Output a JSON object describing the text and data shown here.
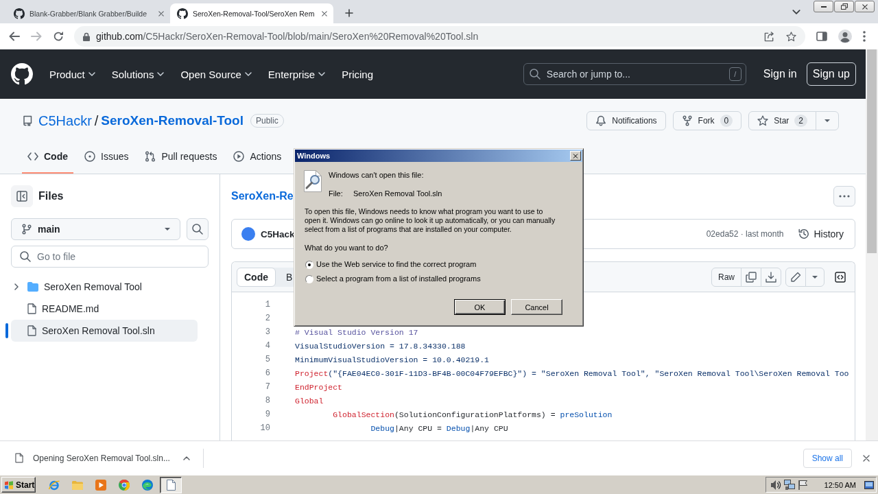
{
  "browser": {
    "tabs": [
      {
        "title": "Blank-Grabber/Blank Grabber/Builde",
        "selected": false
      },
      {
        "title": "SeroXen-Removal-Tool/SeroXen Rem",
        "selected": true
      }
    ],
    "url": {
      "host": "github.com",
      "path": "/C5Hackr/SeroXen-Removal-Tool/blob/main/SeroXen%20Removal%20Tool.sln"
    }
  },
  "header": {
    "nav": [
      {
        "label": "Product",
        "dropdown": true
      },
      {
        "label": "Solutions",
        "dropdown": true
      },
      {
        "label": "Open Source",
        "dropdown": true
      },
      {
        "label": "Enterprise",
        "dropdown": true
      },
      {
        "label": "Pricing",
        "dropdown": false
      }
    ],
    "search": {
      "placeholder": "Search or jump to...",
      "shortcut": "/"
    },
    "sign_in": "Sign in",
    "sign_up": "Sign up"
  },
  "repo": {
    "owner": "C5Hackr",
    "separator": "/",
    "name": "SeroXen-Removal-Tool",
    "visibility": "Public",
    "buttons": [
      {
        "label": "Notifications",
        "dropdown": false
      },
      {
        "label": "Fork",
        "count": "0",
        "dropdown": false
      },
      {
        "label": "Star",
        "count": "2",
        "dropdown": true
      }
    ],
    "tabs": [
      {
        "label": "Code",
        "selected": true
      },
      {
        "label": "Issues",
        "selected": false
      },
      {
        "label": "Pull requests",
        "selected": false
      },
      {
        "label": "Actions",
        "selected": false
      }
    ]
  },
  "sidebar": {
    "title": "Files",
    "branch": "main",
    "file_search": {
      "placeholder": "Go to file"
    },
    "tree": [
      {
        "name": "SeroXen Removal Tool",
        "kind": "folder",
        "expanded": false,
        "selected": false
      },
      {
        "name": "README.md",
        "kind": "file",
        "selected": false
      },
      {
        "name": "SeroXen Removal Tool.sln",
        "kind": "file",
        "selected": true
      }
    ]
  },
  "file": {
    "breadcrumb": "SeroXen-Re",
    "commit": {
      "author": "C5Hack",
      "meta": "02eda52 · last month",
      "history": "History"
    },
    "views": [
      {
        "label": "Code",
        "selected": true
      },
      {
        "label": "B",
        "selected": false
      }
    ],
    "raw": "Raw",
    "lines": [
      {
        "number": "1"
      },
      {
        "number": "2"
      },
      {
        "number": "3",
        "tokens": [
          {
            "text": "# Visual Studio Version 17",
            "kind": "comment"
          }
        ]
      },
      {
        "number": "4",
        "tokens": [
          {
            "text": "VisualStudioVersion = 17.8.34330.188",
            "kind": "string"
          }
        ]
      },
      {
        "number": "5",
        "tokens": [
          {
            "text": "MinimumVisualStudioVersion = 10.0.40219.1",
            "kind": "string"
          }
        ]
      },
      {
        "number": "6",
        "tokens": [
          {
            "text": "Project",
            "kind": "keyword"
          },
          {
            "text": "(\"{FAE04EC0-301F-11D3-BF4B-00C04F79EFBC}\") = \"SeroXen Removal Tool\", \"SeroXen Removal Tool\\SeroXen Removal Too",
            "kind": "string"
          }
        ]
      },
      {
        "number": "7",
        "tokens": [
          {
            "text": "EndProject",
            "kind": "keyword"
          }
        ]
      },
      {
        "number": "8",
        "tokens": [
          {
            "text": "Global",
            "kind": "keyword"
          }
        ]
      },
      {
        "number": "9",
        "tokens": [
          {
            "text": "\tGlobalSection",
            "kind": "keyword"
          },
          {
            "text": "(SolutionConfigurationPlatforms) = ",
            "kind": "plain"
          },
          {
            "text": "preSolution",
            "kind": "constant"
          }
        ]
      },
      {
        "number": "10",
        "tokens": [
          {
            "text": "\t\tDebug",
            "kind": "constant"
          },
          {
            "text": "|Any CPU = ",
            "kind": "plain"
          },
          {
            "text": "Debug",
            "kind": "constant"
          },
          {
            "text": "|Any CPU",
            "kind": "plain"
          }
        ]
      }
    ]
  },
  "downloads": {
    "item": "Opening SeroXen Removal Tool.sln...",
    "show_all": "Show all"
  },
  "dialog": {
    "title": "Windows",
    "heading": "Windows can't open this file:",
    "file_label": "File:",
    "file_name": "SeroXen Removal Tool.sln",
    "message": "To open this file, Windows needs to know what program you want to use to open it. Windows can go online to look it up automatically, or you can manually select from a list of programs that are installed on your computer.",
    "question": "What do you want to do?",
    "options": [
      {
        "label": "Use the Web service to find the correct program",
        "selected": true
      },
      {
        "label": "Select a program from a list of installed programs",
        "selected": false
      }
    ],
    "buttons": [
      {
        "label": "OK",
        "default": true
      },
      {
        "label": "Cancel",
        "default": false
      }
    ]
  },
  "taskbar": {
    "start": "Start",
    "apps": [
      {
        "selected": false
      },
      {
        "selected": false
      },
      {
        "selected": false
      },
      {
        "selected": false
      },
      {
        "selected": false
      },
      {
        "selected": true
      }
    ],
    "clock": "12:50 AM"
  }
}
